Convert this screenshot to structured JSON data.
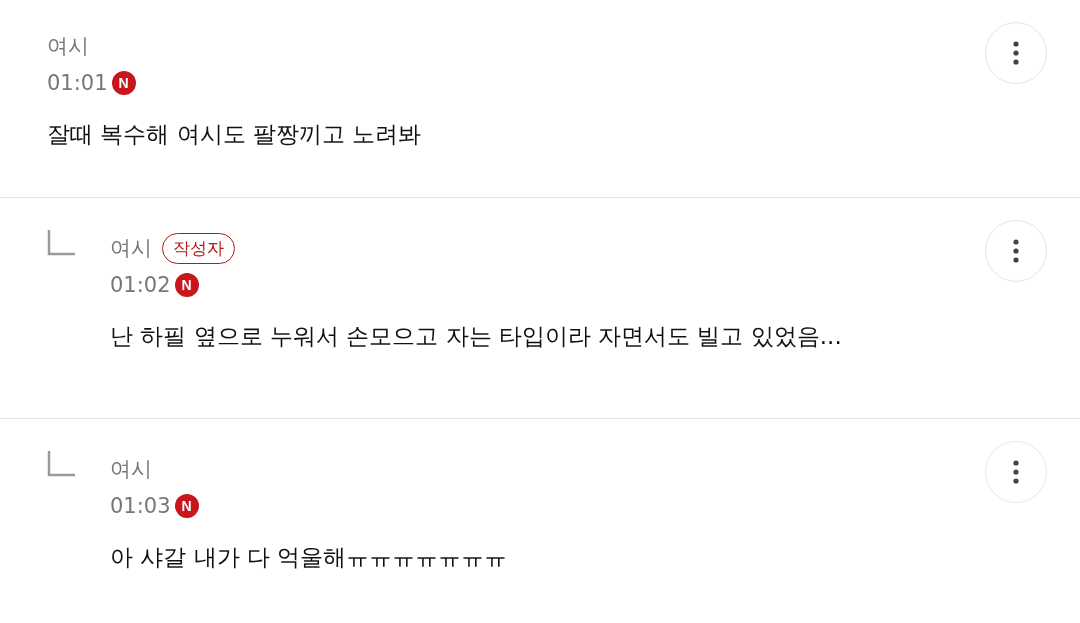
{
  "comments": [
    {
      "kind": "comment",
      "author": "여시",
      "time": "01:01",
      "badge": "N",
      "text": "잘때 복수해 여시도 팔짱끼고 노려봐"
    },
    {
      "kind": "reply",
      "author": "여시",
      "author_tag": "작성자",
      "time": "01:02",
      "badge": "N",
      "text": "난 하필 옆으로 누워서 손모으고 자는 타입이라 자면서도 빌고 있었음..."
    },
    {
      "kind": "reply",
      "author": "여시",
      "time": "01:03",
      "badge": "N",
      "text": "아 샤갈 내가 다 억울해ㅠㅠㅠㅠㅠㅠㅠ"
    }
  ]
}
